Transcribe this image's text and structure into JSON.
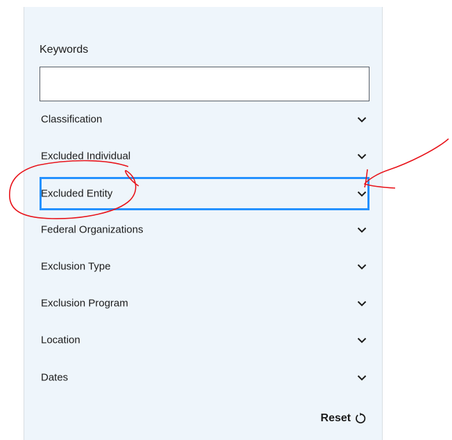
{
  "filters": {
    "keywords_label": "Keywords",
    "keywords_value": "",
    "keywords_placeholder": "",
    "accordion": [
      {
        "label": "Classification"
      },
      {
        "label": "Excluded Individual"
      },
      {
        "label": "Excluded Entity",
        "focused": true
      },
      {
        "label": "Federal Organizations"
      },
      {
        "label": "Exclusion Type"
      },
      {
        "label": "Exclusion Program"
      },
      {
        "label": "Location"
      },
      {
        "label": "Dates"
      }
    ],
    "reset_label": "Reset"
  },
  "icons": {
    "chevron": "chevron-down-icon",
    "reset": "reset-icon"
  },
  "colors": {
    "panel_bg": "#eef5fb",
    "focus_outline": "#2491ff",
    "annotation": "#e8141b",
    "text": "#1b1b1b"
  }
}
